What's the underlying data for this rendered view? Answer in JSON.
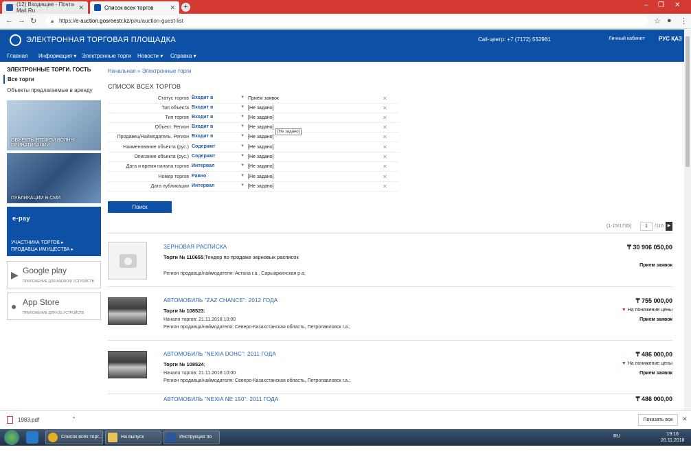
{
  "browser": {
    "tabs": [
      {
        "label": "(12) Входящие - Почта Mail.Ru",
        "active": false
      },
      {
        "label": "Список всех торгов",
        "active": true
      }
    ],
    "url_prefix": "https://",
    "url_host": "e-auction.gosreestr.kz",
    "url_path": "/p/ru/auction-guest-list"
  },
  "header": {
    "site_title": "ЭЛЕКТРОННАЯ ТОРГОВАЯ ПЛОЩАДКА",
    "call_center": "Call-центр: +7 (7172) 552981",
    "cabinet": "Личный кабинет",
    "lang": "РУС ҚАЗ"
  },
  "menu": {
    "items": [
      "Главная",
      "Информация ▾",
      "Электронные торги",
      "Новости ▾",
      "Справка ▾"
    ]
  },
  "sidebar": {
    "title": "ЭЛЕКТРОННЫЕ ТОРГИ. ГОСТЬ",
    "all": "Все торги",
    "rent": "Объекты предлагаемые в аренду",
    "banner1": [
      "ОБЪЕКТЫ ВТОРОЙ ВОЛНЫ",
      "ПРИВАТИЗАЦИИ"
    ],
    "banner2": "ПУБЛИКАЦИИ В СМИ",
    "banner3_logo": "e-pay",
    "banner3": [
      "УЧАСТНИКА ТОРГОВ ▸",
      "ПРОДАВЦА ИМУЩЕСТВА ▸"
    ],
    "google_play": {
      "name": "Google play",
      "sub": "ПРИЛОЖЕНИЕ ДЛЯ ANDROID УСТРОЙСТВ"
    },
    "app_store": {
      "name": "App Store",
      "sub": "ПРИЛОЖЕНИЕ ДЛЯ IOS УСТРОЙСТВ"
    }
  },
  "main": {
    "breadcrumb": "Начальная » Электронные торги",
    "title": "СПИСОК ВСЕХ ТОРГОВ",
    "filters": [
      {
        "label": "Статус торгов",
        "op": "Входит в",
        "value": "Прием заявок"
      },
      {
        "label": "Тип объекта",
        "op": "Входит в",
        "value": "[Не задано]"
      },
      {
        "label": "Тип торгов",
        "op": "Входит в",
        "value": "[Не задано]"
      },
      {
        "label": "Объект. Регион",
        "op": "Входит в",
        "value": "[Не задано]"
      },
      {
        "label": "Продавец/Наймодатель. Регион",
        "op": "Входит в",
        "value": "[Не задано]"
      },
      {
        "label": "Наименование объекта (рус.)",
        "op": "Содержит",
        "value": "[Не задано]"
      },
      {
        "label": "Описание объекта (рус.)",
        "op": "Содержит",
        "value": "[Не задано]"
      },
      {
        "label": "Дата и время начала торгов",
        "op": "Интервал",
        "value": "[Не задано]"
      },
      {
        "label": "Номер торгов",
        "op": "Равно",
        "value": "[Не задано]"
      },
      {
        "label": "Дата публикации",
        "op": "Интервал",
        "value": "[Не задано]"
      }
    ],
    "tooltip": "[Не задано]",
    "search_button": "Поиск",
    "pager": {
      "range": "(1-15/1735)",
      "page": "1",
      "total": "/116"
    }
  },
  "items": [
    {
      "title": "ЗЕРНОВАЯ РАСПИСКА",
      "num_label": "Торги № 110655",
      "num_rest": ";Тендер по продаже зерновых расписок",
      "line1": "",
      "line2": "Регион продавца/наймодателя:  Астана г.а.,  Сарыаркинская р.а;",
      "price": "₸ 30 906 050,00",
      "down": "",
      "status": "Прием заявок",
      "thumb": "placeholder"
    },
    {
      "title": "АВТОМОБИЛЬ \"ZAZ CHANCE\": 2012 ГОДА",
      "num_label": "Торги № 108523",
      "num_rest": ";",
      "line1": "Начало торгов: 21.11.2018 10:00",
      "line2": "Регион продавца/наймодателя:  Северо-Казахстанская область,  Петропавловск г.а.;",
      "price": "₸ 755 000,00",
      "down": "На понижение цены",
      "status": "Прием заявок",
      "thumb": "car"
    },
    {
      "title": "АВТОМОБИЛЬ \"NEXIA DOHC\": 2011 ГОДА",
      "num_label": "Торги № 108524",
      "num_rest": ";",
      "line1": "Начало торгов: 21.11.2018 10:00",
      "line2": "Регион продавца/наймодателя:  Северо-Казахстанская область,  Петропавловск г.а.;",
      "price": "₸ 486 000,00",
      "down": "На понижение цены",
      "status": "Прием заявок",
      "thumb": "car"
    },
    {
      "title": "АВТОМОБИЛЬ \"NEXIA NE 150\": 2011 ГОДА",
      "num_label": "",
      "num_rest": "",
      "line1": "",
      "line2": "",
      "price": "₸ 486 000,00",
      "down": "",
      "status": "",
      "thumb": "car"
    }
  ],
  "download": {
    "file": "1983.pdf",
    "show_all": "Показать все"
  },
  "taskbar": {
    "buttons": [
      "Список всех торг...",
      "На выпуск октяб...",
      "Инструкция по п..."
    ],
    "lang": "RU",
    "time": "19:16",
    "date": "20.11.2018"
  }
}
